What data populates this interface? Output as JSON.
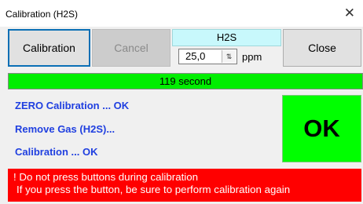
{
  "window": {
    "title": "Calibration (H2S)",
    "close_glyph": "✕"
  },
  "toolbar": {
    "calibration_label": "Calibration",
    "cancel_label": "Cancel",
    "close_label": "Close"
  },
  "gas": {
    "name": "H2S",
    "concentration": "25,0",
    "unit": "ppm",
    "spin_icon": "⇅"
  },
  "progress": {
    "text": "119 second",
    "fraction": 1.0
  },
  "status": {
    "line1": "ZERO Calibration ... OK",
    "line2": "Remove Gas (H2S)...",
    "line3": "Calibration ... OK"
  },
  "result": {
    "text": "OK"
  },
  "warning": {
    "line1": "! Do not press buttons during calibration",
    "line2": "If you press the button, be sure to perform calibration again"
  },
  "colors": {
    "progress_fill": "#00ee00",
    "ok_box": "#00ff00",
    "warning_bg": "#ff0000",
    "status_text": "#1f3fe0",
    "gas_label_bg": "#c8f8fc"
  }
}
